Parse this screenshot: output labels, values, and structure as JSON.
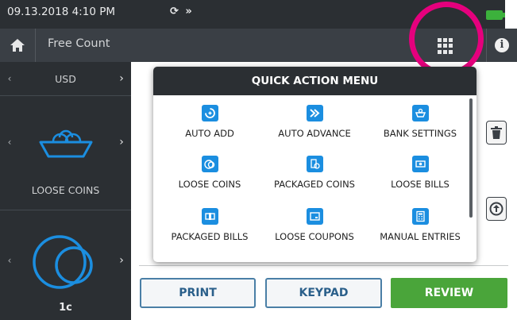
{
  "status": {
    "datetime": "09.13.2018  4:10 PM",
    "mode_icons": "⟳ »",
    "battery_color": "#3cb13c"
  },
  "header": {
    "title": "Free Count"
  },
  "left_panel": {
    "currency": "USD",
    "category_label": "LOOSE COINS",
    "denomination_label": "1c"
  },
  "quick_action_menu": {
    "title": "QUICK ACTION MENU",
    "items": [
      {
        "label": "AUTO ADD",
        "icon": "auto-add-icon"
      },
      {
        "label": "AUTO ADVANCE",
        "icon": "auto-advance-icon"
      },
      {
        "label": "BANK SETTINGS",
        "icon": "bank-settings-icon"
      },
      {
        "label": "LOOSE COINS",
        "icon": "loose-coins-icon"
      },
      {
        "label": "PACKAGED COINS",
        "icon": "packaged-coins-icon"
      },
      {
        "label": "LOOSE BILLS",
        "icon": "loose-bills-icon"
      },
      {
        "label": "PACKAGED BILLS",
        "icon": "packaged-bills-icon"
      },
      {
        "label": "LOOSE COUPONS",
        "icon": "loose-coupons-icon"
      },
      {
        "label": "MANUAL ENTRIES",
        "icon": "manual-entries-icon"
      }
    ]
  },
  "actions": {
    "print": "PRINT",
    "keypad": "KEYPAD",
    "review": "REVIEW"
  },
  "colors": {
    "accent_blue": "#1b8ee0",
    "highlight": "#e5007d",
    "review_green": "#4aa53a",
    "dark_bar": "#2b2f33"
  }
}
